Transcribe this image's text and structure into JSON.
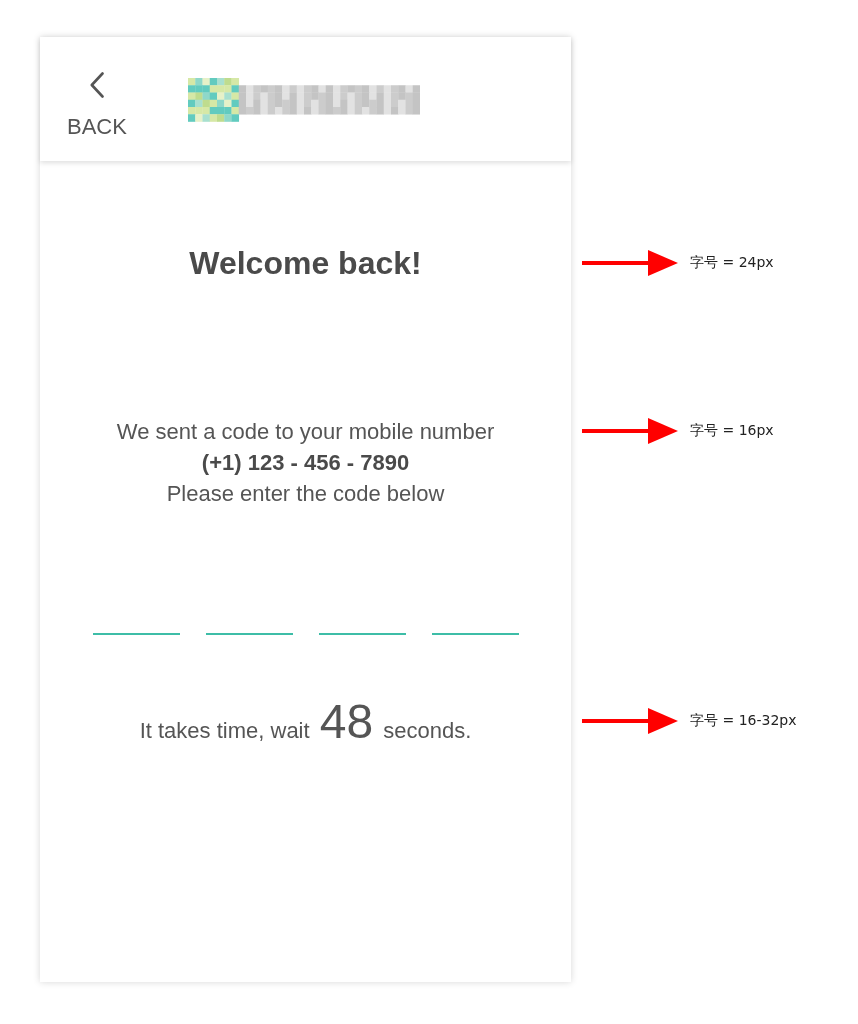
{
  "header": {
    "back_label": "BACK"
  },
  "welcome": {
    "title": "Welcome back!",
    "annotation": "字号 = 24px"
  },
  "message": {
    "line_1": "We sent a code to your mobile number",
    "phone": "(+1) 123 - 456 - 7890",
    "line_2": "Please enter the code below",
    "annotation": "字号 = 16px"
  },
  "code_fields": [
    {
      "focused": false
    },
    {
      "focused": false
    },
    {
      "focused": false
    },
    {
      "focused": false
    }
  ],
  "timer": {
    "before": "It takes time, wait",
    "seconds": "48",
    "after": "seconds.",
    "annotation": "字号 = 16-32px"
  }
}
